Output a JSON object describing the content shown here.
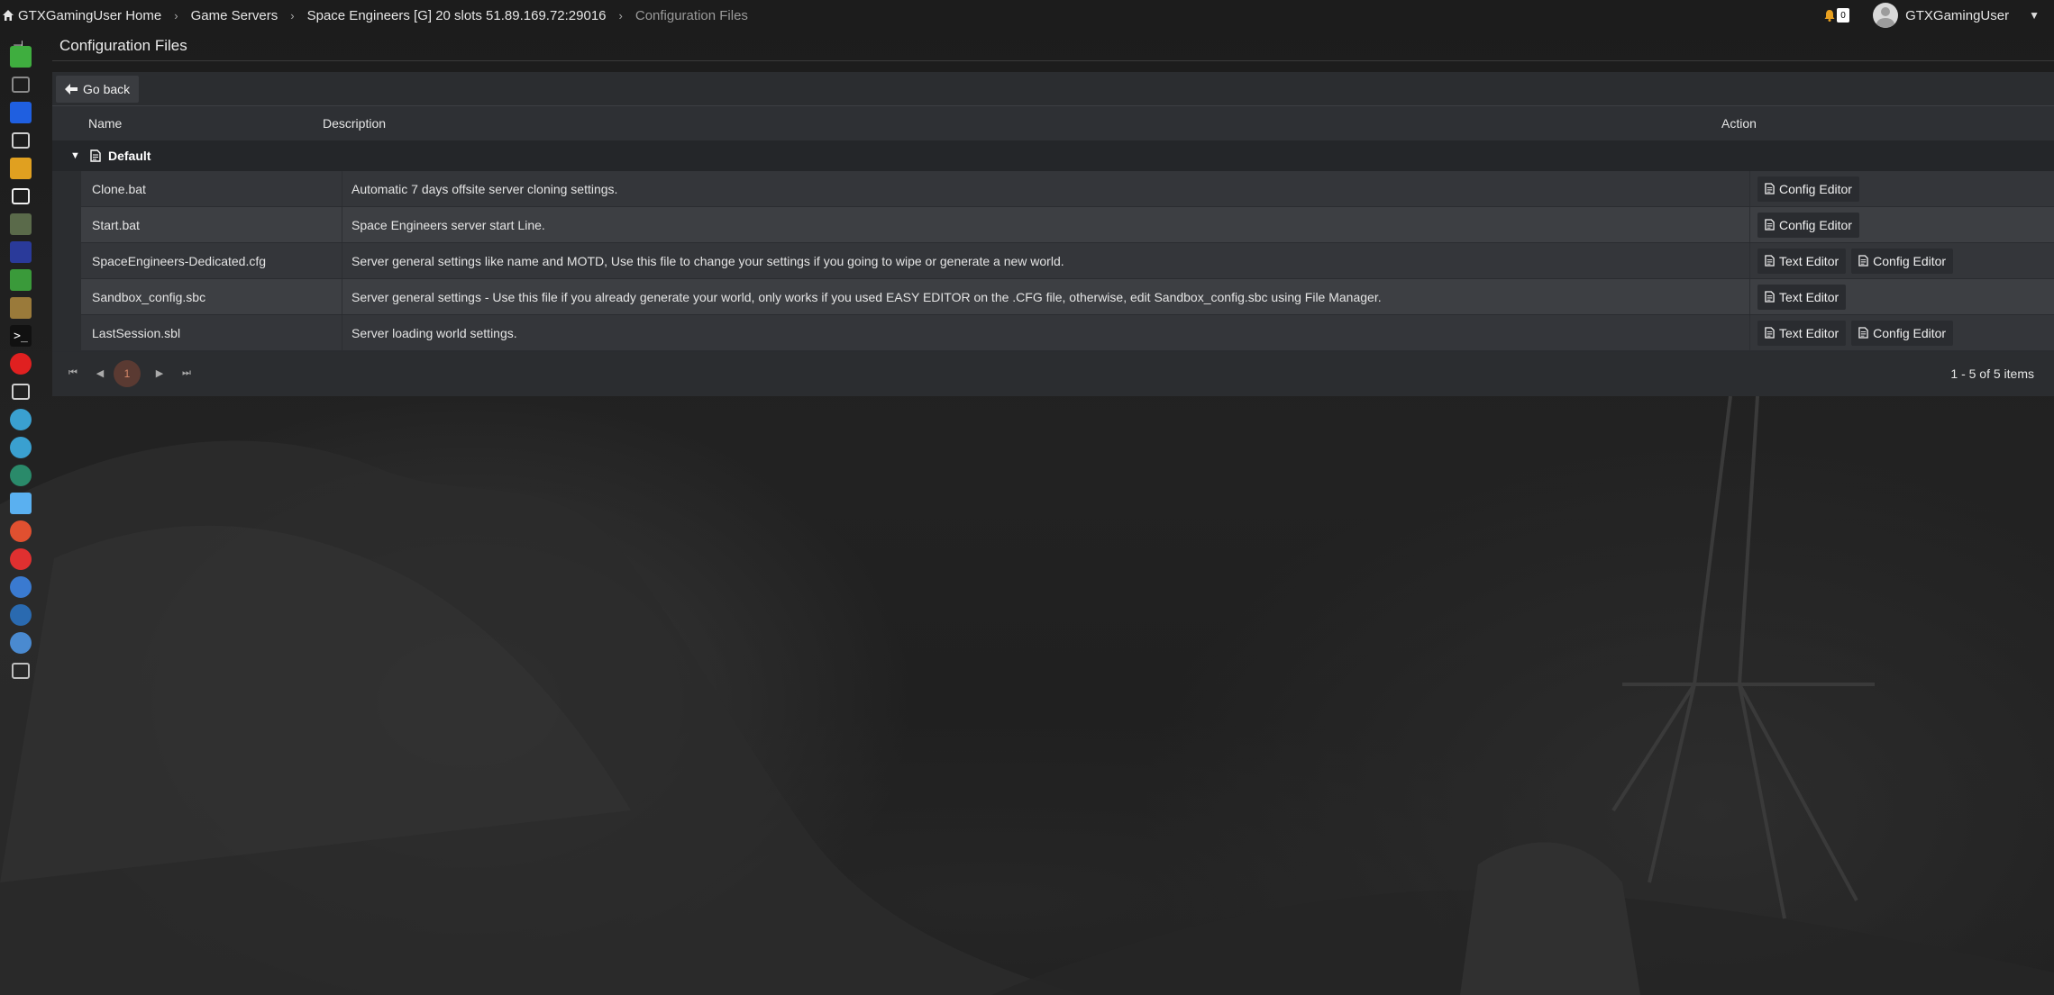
{
  "breadcrumb": {
    "home": "GTXGamingUser Home",
    "items": [
      "Game Servers",
      "Space Engineers [G] 20 slots 51.89.169.72:29016",
      "Configuration Files"
    ]
  },
  "header": {
    "notification_count": "0",
    "username": "GTXGamingUser"
  },
  "page": {
    "title": "Configuration Files"
  },
  "toolbar": {
    "back_label": "Go back"
  },
  "table": {
    "columns": {
      "name": "Name",
      "description": "Description",
      "action": "Action"
    },
    "group": "Default",
    "rows": [
      {
        "name": "Clone.bat",
        "description": "Automatic 7 days offsite server cloning settings.",
        "actions": [
          "Config Editor"
        ]
      },
      {
        "name": "Start.bat",
        "description": "Space Engineers server start Line.",
        "actions": [
          "Config Editor"
        ]
      },
      {
        "name": "SpaceEngineers-Dedicated.cfg",
        "description": "Server general settings like name and MOTD, Use this file to change your settings if you going to wipe or generate a new world.",
        "actions": [
          "Text Editor",
          "Config Editor"
        ]
      },
      {
        "name": "Sandbox_config.sbc",
        "description": "Server general settings - Use this file if you already generate your world, only works if you used EASY EDITOR on the .CFG file, otherwise, edit Sandbox_config.sbc using File Manager.",
        "actions": [
          "Text Editor"
        ]
      },
      {
        "name": "LastSession.sbl",
        "description": "Server loading world settings.",
        "actions": [
          "Text Editor",
          "Config Editor"
        ]
      }
    ]
  },
  "pager": {
    "current_page": "1",
    "info": "1 - 5 of 5 items"
  },
  "sidebar": {
    "icons": [
      {
        "name": "gamepad-icon",
        "color": "#3fae3f"
      },
      {
        "name": "sliders-icon",
        "color": "#8a8a8a"
      },
      {
        "name": "cloud-upload-icon",
        "color": "#1f5fe0"
      },
      {
        "name": "flask-icon",
        "color": "#d0d0d0"
      },
      {
        "name": "folder-icon",
        "color": "#e0a020"
      },
      {
        "name": "file-edit-icon",
        "color": "#f0f0f0"
      },
      {
        "name": "steam-workshop-icon",
        "color": "#5a6a4a"
      },
      {
        "name": "mods-blue-icon",
        "color": "#2a3a9a"
      },
      {
        "name": "mods-green-icon",
        "color": "#3a9a3a"
      },
      {
        "name": "mods-orange-icon",
        "color": "#9a7a3a"
      },
      {
        "name": "terminal-icon",
        "color": "#111111"
      },
      {
        "name": "clock-icon",
        "color": "#e02020"
      },
      {
        "name": "chart-icon",
        "color": "#d0d0d0"
      },
      {
        "name": "umbrella-icon",
        "color": "#3aa0d0"
      },
      {
        "name": "support-icon",
        "color": "#3aa0d0"
      },
      {
        "name": "user-green-icon",
        "color": "#2a8a6a"
      },
      {
        "name": "database-icon",
        "color": "#5ab0f0"
      },
      {
        "name": "user-orange-icon",
        "color": "#e05030"
      },
      {
        "name": "first-aid-icon",
        "color": "#e03030"
      },
      {
        "name": "book-icon",
        "color": "#3a7ad0"
      },
      {
        "name": "person-icon",
        "color": "#2a6ab0"
      },
      {
        "name": "swirl-icon",
        "color": "#4a8ad0"
      },
      {
        "name": "settings-icon",
        "color": "#c0c0c0"
      }
    ]
  }
}
